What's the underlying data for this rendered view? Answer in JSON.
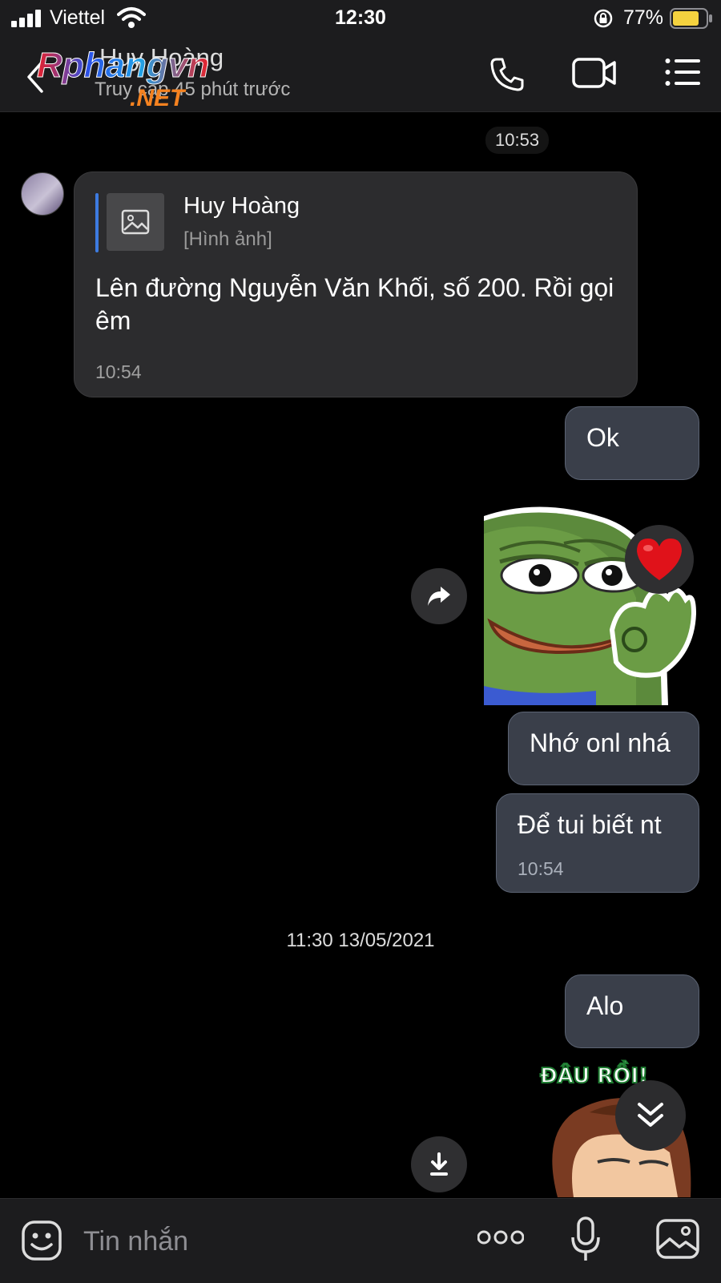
{
  "status_bar": {
    "carrier": "Viettel",
    "time": "12:30",
    "battery": "77%"
  },
  "header": {
    "contact_name": "Huy Hoàng",
    "last_seen": "Truy cập 45 phút trước",
    "watermark_text": "Rphangvn .NET"
  },
  "chat": {
    "top_time_chip": "10:53",
    "incoming": {
      "reply_to_name": "Huy Hoàng",
      "reply_to_type": "[Hình ảnh]",
      "text": "Lên đường Nguyễn Văn Khối, số 200. Rồi gọi êm",
      "time": "10:54"
    },
    "outgoing_1": {
      "text": "Ok"
    },
    "sticker_1": {
      "name": "pepe-ok-sticker",
      "reaction": "heart"
    },
    "outgoing_2": {
      "text": "Nhớ onl nhá"
    },
    "outgoing_3": {
      "text": "Để tui biết nt",
      "time": "10:54"
    },
    "date_separator": "11:30 13/05/2021",
    "outgoing_4": {
      "text": "Alo"
    },
    "sticker_2": {
      "caption": "ĐÂU RỒI!"
    }
  },
  "input": {
    "placeholder": "Tin nhắn"
  },
  "icons": {
    "back": "chevron-left-icon",
    "call": "phone-icon",
    "video": "video-icon",
    "menu": "list-icon",
    "share": "share-icon",
    "download": "download-icon",
    "scroll_down": "double-chevron-down-icon",
    "emoji": "emoji-icon",
    "more": "more-icon",
    "mic": "mic-icon",
    "gallery": "gallery-icon"
  },
  "colors": {
    "accent": "#3d7be0",
    "bubble_out": "#3a3f4a",
    "bubble_in": "#2c2c2e",
    "heart": "#e0121a"
  }
}
